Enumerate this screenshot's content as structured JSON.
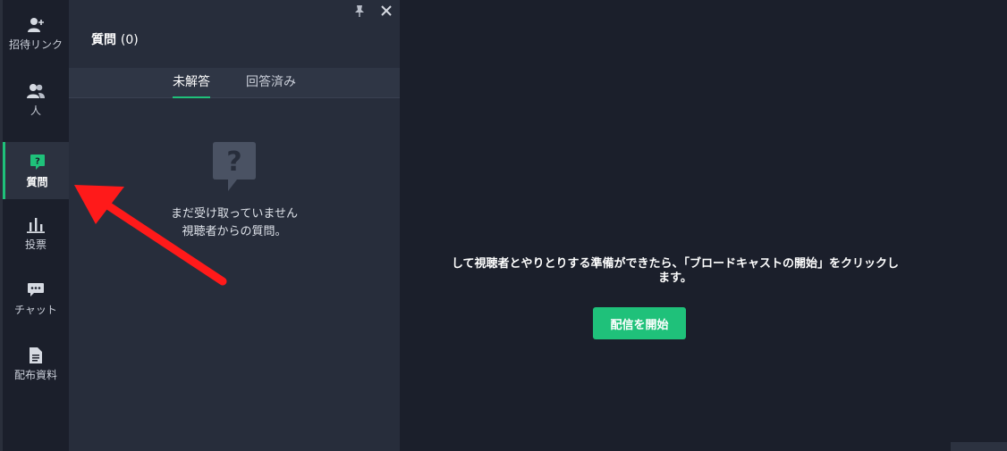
{
  "sidebar": {
    "items": [
      {
        "label": "招待リンク",
        "icon": "add-user-icon"
      },
      {
        "label": "人",
        "icon": "people-icon"
      },
      {
        "label": "質問",
        "icon": "question-icon",
        "active": true
      },
      {
        "label": "投票",
        "icon": "poll-icon"
      },
      {
        "label": "チャット",
        "icon": "chat-icon"
      },
      {
        "label": "配布資料",
        "icon": "document-icon"
      }
    ]
  },
  "panel": {
    "title": "質問",
    "count": "(0)",
    "tabs": [
      {
        "label": "未解答",
        "active": true
      },
      {
        "label": "回答済み",
        "active": false
      }
    ],
    "empty_line1": "まだ受け取っていません",
    "empty_line2": "視聴者からの質問。"
  },
  "main": {
    "message_line1": "して視聴者とやりとりする準備ができたら、「ブロードキャストの開始」をクリックし",
    "message_line2": "ます。",
    "start_button": "配信を開始"
  },
  "colors": {
    "accent": "#1fc17a",
    "background": "#1b1f2b",
    "panel": "#272d3b",
    "annotation_arrow": "#ff1a1a"
  }
}
